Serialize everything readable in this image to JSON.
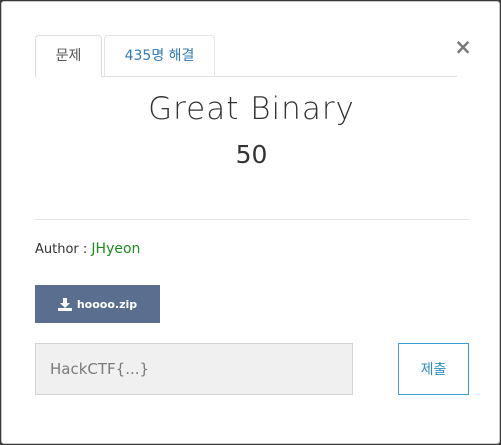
{
  "modal": {
    "tabs": [
      {
        "label": "문제",
        "active": true
      },
      {
        "label": "435명 해결",
        "active": false
      }
    ],
    "close_label": "×"
  },
  "challenge": {
    "name": "Great Binary",
    "value": "50",
    "author_label": "Author : ",
    "author_name": "JHyeon",
    "file_label": "hoooo.zip"
  },
  "submission": {
    "placeholder": "HackCTF{...}",
    "value": "",
    "submit_label": "제출"
  },
  "colors": {
    "download_button": "#5a6f90",
    "author_name": "#1f8a1f",
    "tab_link": "#337ab7",
    "submit_border": "#3aa0d0"
  }
}
